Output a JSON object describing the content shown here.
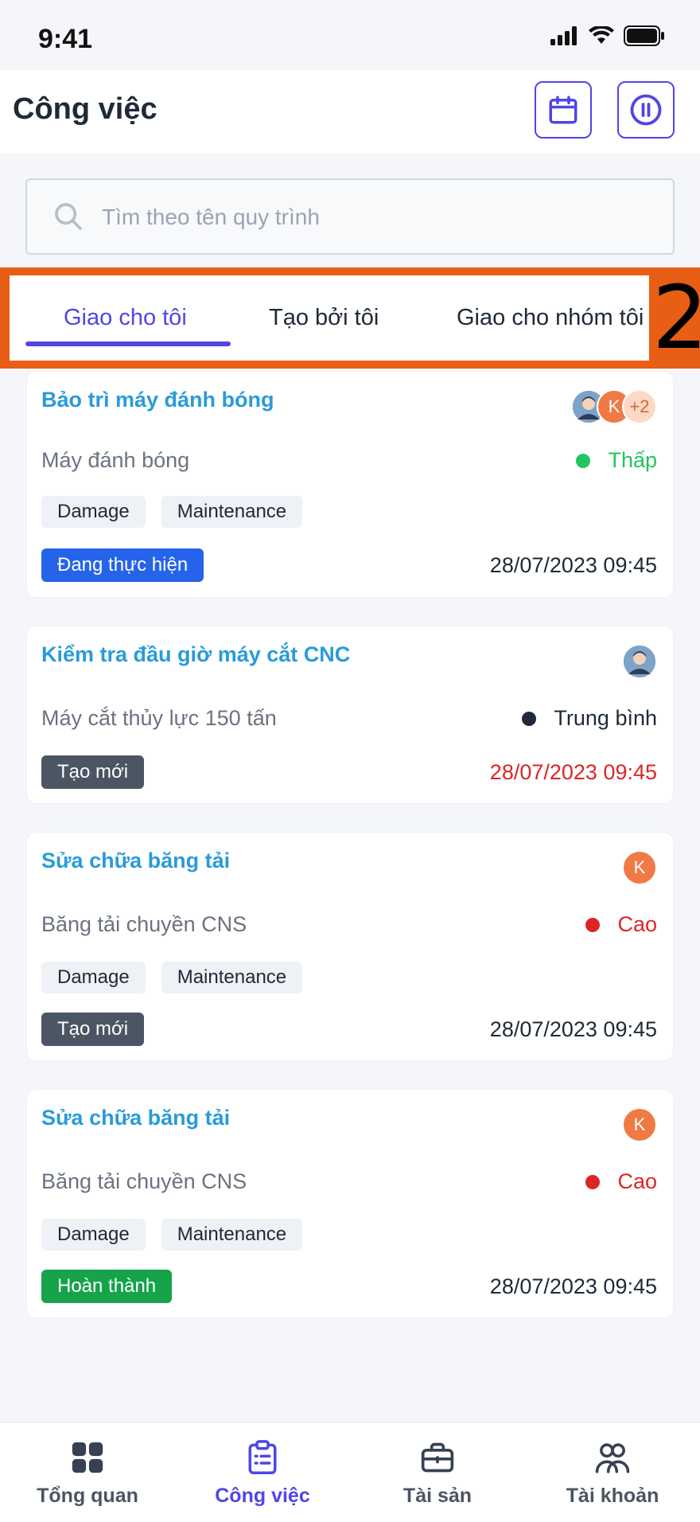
{
  "status_bar": {
    "time": "9:41"
  },
  "header": {
    "title": "Công việc"
  },
  "search": {
    "placeholder": "Tìm theo tên quy trình"
  },
  "tabs": [
    {
      "label": "Giao cho tôi",
      "active": true
    },
    {
      "label": "Tạo bởi tôi",
      "active": false
    },
    {
      "label": "Giao cho nhóm tôi",
      "active": false
    }
  ],
  "annotation": {
    "number": "2"
  },
  "tasks": [
    {
      "title": "Bảo trì máy đánh bóng",
      "asset": "Máy đánh bóng",
      "priority": "Thấp",
      "priority_color": "#22c55e",
      "tags": [
        "Damage",
        "Maintenance"
      ],
      "status": "Đang thực hiện",
      "status_color": "#2563eb",
      "date": "28/07/2023 09:45",
      "date_color": "#1f2937",
      "avatars": {
        "k": "K",
        "extra": "+2"
      }
    },
    {
      "title": "Kiểm tra đầu giờ máy cắt CNC",
      "asset": "Máy cắt thủy lực 150 tấn",
      "priority": "Trung bình",
      "priority_color": "#1f2937",
      "status": "Tạo mới",
      "status_color": "#4b5563",
      "date": "28/07/2023 09:45",
      "date_color": "#dc2626"
    },
    {
      "title": "Sửa chữa băng tải",
      "asset": "Băng tải chuyền CNS",
      "priority": "Cao",
      "priority_color": "#dc2626",
      "tags": [
        "Damage",
        "Maintenance"
      ],
      "status": "Tạo mới",
      "status_color": "#4b5563",
      "date": "28/07/2023 09:45",
      "date_color": "#1f2937",
      "avatars": {
        "k": "K"
      }
    },
    {
      "title": "Sửa chữa băng tải",
      "asset": "Băng tải chuyền CNS",
      "priority": "Cao",
      "priority_color": "#dc2626",
      "tags": [
        "Damage",
        "Maintenance"
      ],
      "status": "Hoàn thành",
      "status_color": "#16a34a",
      "date": "28/07/2023 09:45",
      "date_color": "#1f2937",
      "avatars": {
        "k": "K"
      }
    }
  ],
  "bottom_nav": [
    {
      "label": "Tổng quan",
      "icon": "grid-icon",
      "active": false
    },
    {
      "label": "Công việc",
      "icon": "clipboard-icon",
      "active": true
    },
    {
      "label": "Tài sản",
      "icon": "briefcase-icon",
      "active": false
    },
    {
      "label": "Tài khoản",
      "icon": "users-icon",
      "active": false
    }
  ],
  "colors": {
    "accent": "#4f46e5",
    "title_blue": "#2a9bd8",
    "annotation_frame": "#e85e14"
  }
}
